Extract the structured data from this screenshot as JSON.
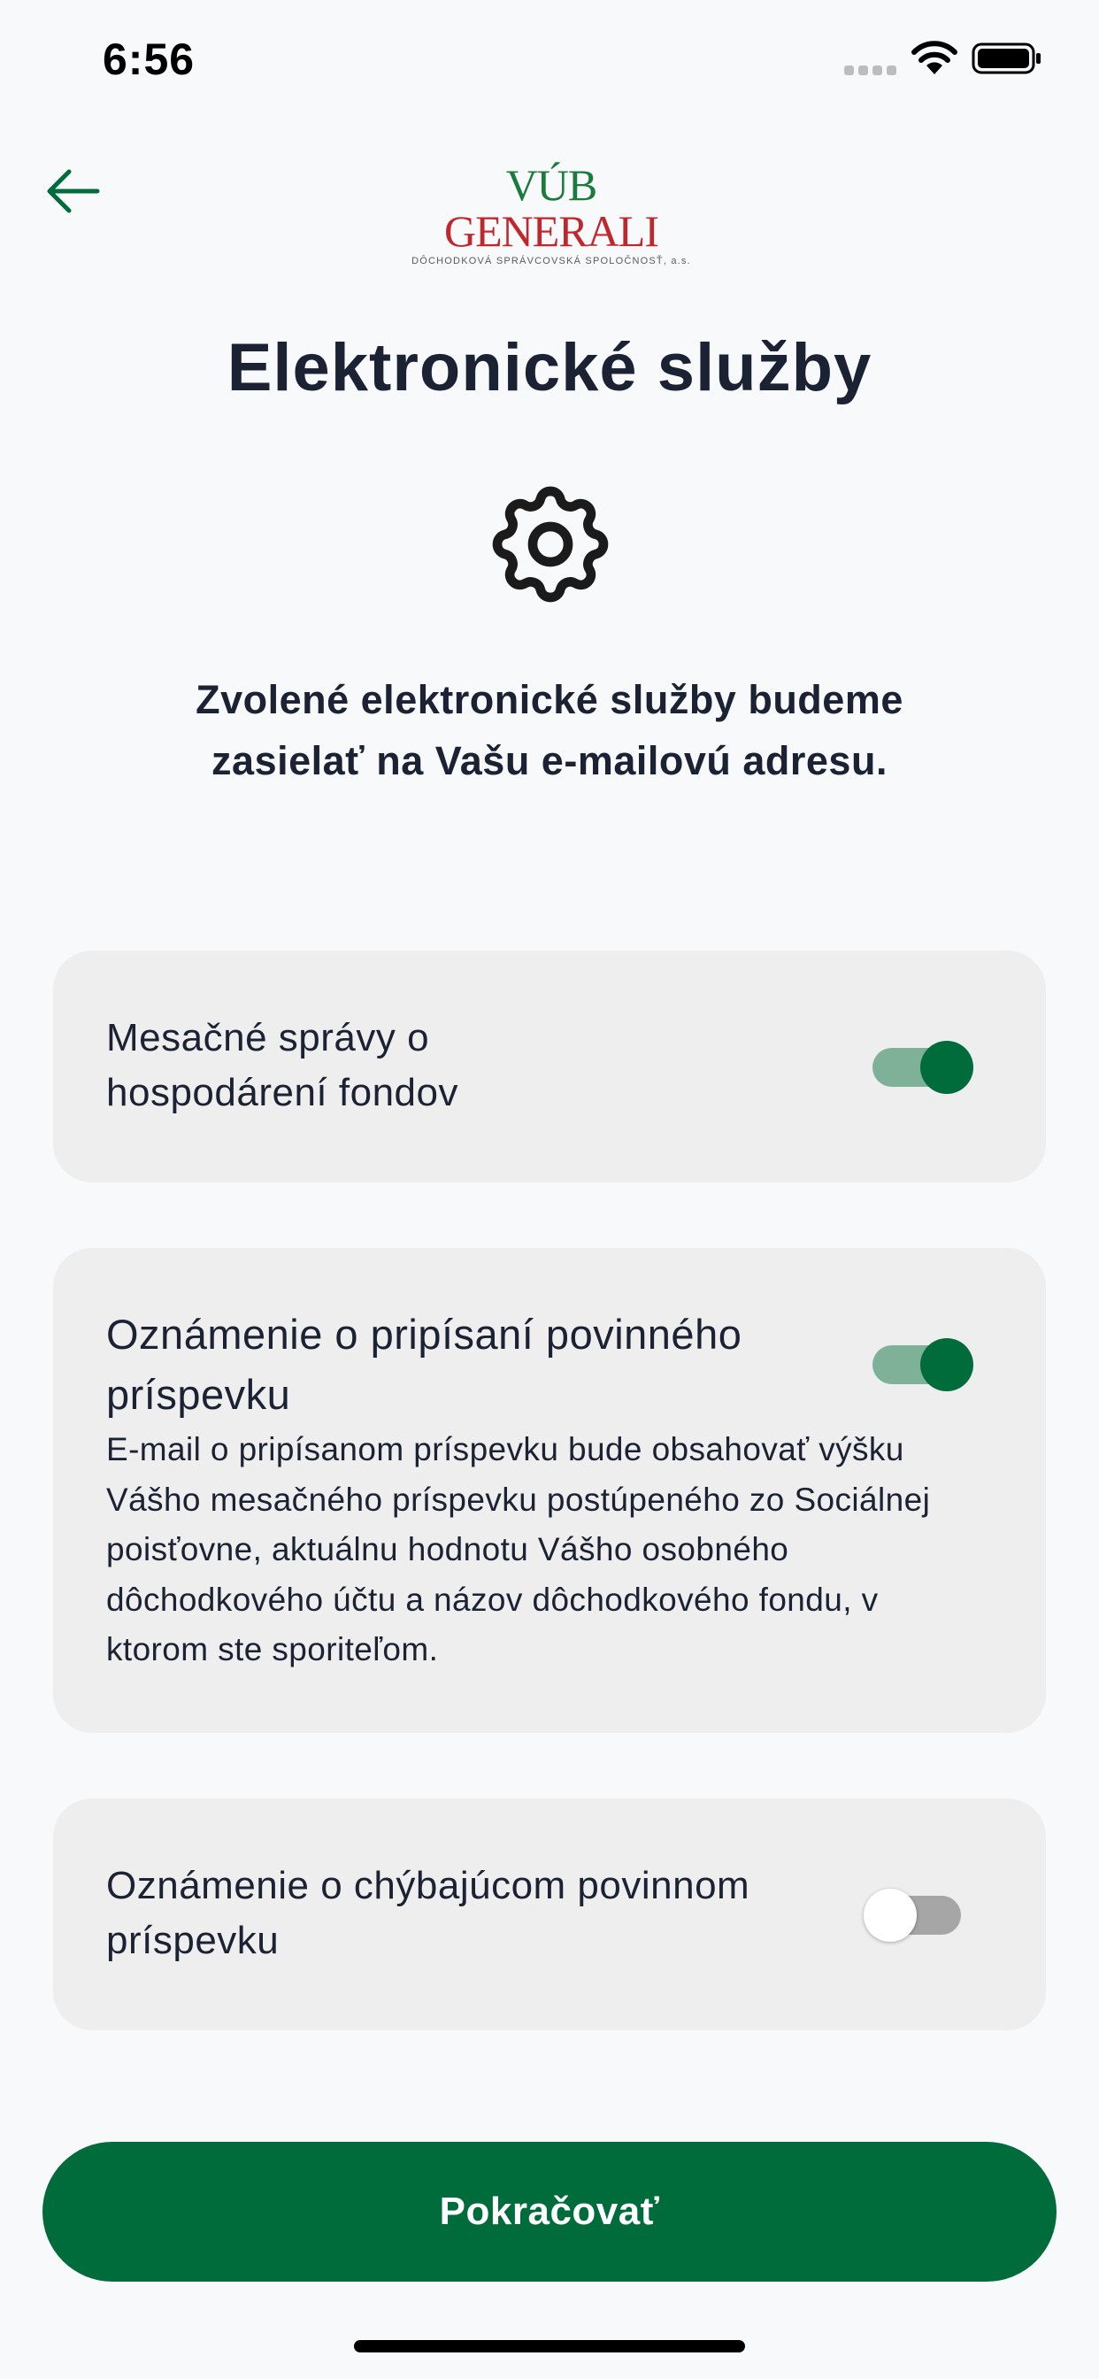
{
  "status_bar": {
    "time": "6:56",
    "icons": [
      "signal-icon",
      "wifi-icon",
      "battery-icon"
    ]
  },
  "header": {
    "back_icon": "arrow-left-icon",
    "logo": {
      "vub": "VÚB",
      "generali": "GENERALI",
      "subtitle": "DÔCHODKOVÁ SPRÁVCOVSKÁ SPOLOČNOSŤ, a.s."
    }
  },
  "page": {
    "title": "Elektronické služby",
    "icon": "gear-icon",
    "intro": "Zvolené elektronické služby budeme zasielať na Vašu e-mailovú adresu."
  },
  "services": [
    {
      "title": "Mesačné správy o hospodárení fondov",
      "enabled": true
    },
    {
      "title": "Oznámenie o pripísaní povinného príspevku",
      "description": "E-mail o pripísanom príspevku bude obsahovať výšku Vášho mesačného príspevku postúpeného zo Sociálnej poisťovne, aktuálnu hodnotu Vášho osobného dôchodkového účtu a názov dôchodkového fondu, v ktorom ste sporiteľom.",
      "enabled": true
    },
    {
      "title": "Oznámenie o chýbajúcom povinnom príspevku",
      "enabled": false
    }
  ],
  "footer": {
    "continue_label": "Pokračovať"
  },
  "colors": {
    "accent": "#006b3b",
    "toggle_on_track": "#7fb199",
    "logo_red": "#c0272d",
    "logo_green": "#1b7a3d",
    "card_bg": "#eeeeee"
  }
}
